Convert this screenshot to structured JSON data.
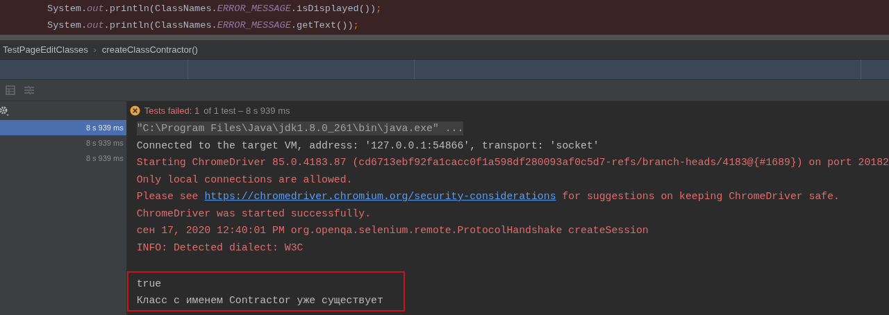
{
  "editor": {
    "lines": [
      {
        "tokens": [
          {
            "text": "System.",
            "kind": "plain"
          },
          {
            "text": "out",
            "kind": "field"
          },
          {
            "text": ".println(ClassNames.",
            "kind": "plain"
          },
          {
            "text": "ERROR_MESSAGE",
            "kind": "field"
          },
          {
            "text": ".isDisplayed())",
            "kind": "plain"
          },
          {
            "text": ";",
            "kind": "punct"
          }
        ]
      },
      {
        "tokens": [
          {
            "text": "System.",
            "kind": "plain"
          },
          {
            "text": "out",
            "kind": "field"
          },
          {
            "text": ".println(ClassNames.",
            "kind": "plain"
          },
          {
            "text": "ERROR_MESSAGE",
            "kind": "field"
          },
          {
            "text": ".getText())",
            "kind": "plain"
          },
          {
            "text": ";",
            "kind": "punct"
          }
        ]
      }
    ]
  },
  "breadcrumbs": [
    "TestPageEditClasses",
    "›",
    "createClassContractor()"
  ],
  "test_tree": {
    "rows": [
      {
        "duration": "8 s 939 ms",
        "selected": true
      },
      {
        "duration": "8 s 939 ms",
        "selected": false
      },
      {
        "duration": "8 s 939 ms",
        "selected": false
      }
    ]
  },
  "status": {
    "label": "Tests failed: 1",
    "detail": "of 1 test – 8 s 939 ms"
  },
  "console": {
    "lines": [
      {
        "kind": "command",
        "parts": [
          {
            "text": "\"C:\\Program Files\\Java\\jdk1.8.0_261\\bin\\java.exe\" ...",
            "kind": "text"
          }
        ]
      },
      {
        "kind": "stdout",
        "parts": [
          {
            "text": "Connected to the target VM, address: '127.0.0.1:54866', transport: 'socket'",
            "kind": "text"
          }
        ]
      },
      {
        "kind": "stderr",
        "parts": [
          {
            "text": "Starting ChromeDriver 85.0.4183.87 (cd6713ebf92fa1cacc0f1a598df280093af0c5d7-refs/branch-heads/4183@{#1689}) on port 20182",
            "kind": "text"
          }
        ]
      },
      {
        "kind": "stderr",
        "parts": [
          {
            "text": "Only local connections are allowed.",
            "kind": "text"
          }
        ]
      },
      {
        "kind": "stderr",
        "parts": [
          {
            "text": "Please see ",
            "kind": "text"
          },
          {
            "text": "https://chromedriver.chromium.org/security-considerations",
            "kind": "link"
          },
          {
            "text": " for suggestions on keeping ChromeDriver safe.",
            "kind": "text"
          }
        ]
      },
      {
        "kind": "stderr",
        "parts": [
          {
            "text": "ChromeDriver was started successfully.",
            "kind": "text"
          }
        ]
      },
      {
        "kind": "stderr",
        "parts": [
          {
            "text": "сен 17, 2020 12:40:01 PM org.openqa.selenium.remote.ProtocolHandshake createSession",
            "kind": "text"
          }
        ]
      },
      {
        "kind": "stderr",
        "parts": [
          {
            "text": "INFO: Detected dialect: W3C",
            "kind": "text"
          }
        ]
      }
    ],
    "boxed_lines": [
      {
        "kind": "stdout",
        "parts": [
          {
            "text": "true",
            "kind": "text"
          }
        ]
      },
      {
        "kind": "stdout",
        "parts": [
          {
            "text": "Класс с именем Contractor уже существует",
            "kind": "text"
          }
        ]
      }
    ]
  }
}
